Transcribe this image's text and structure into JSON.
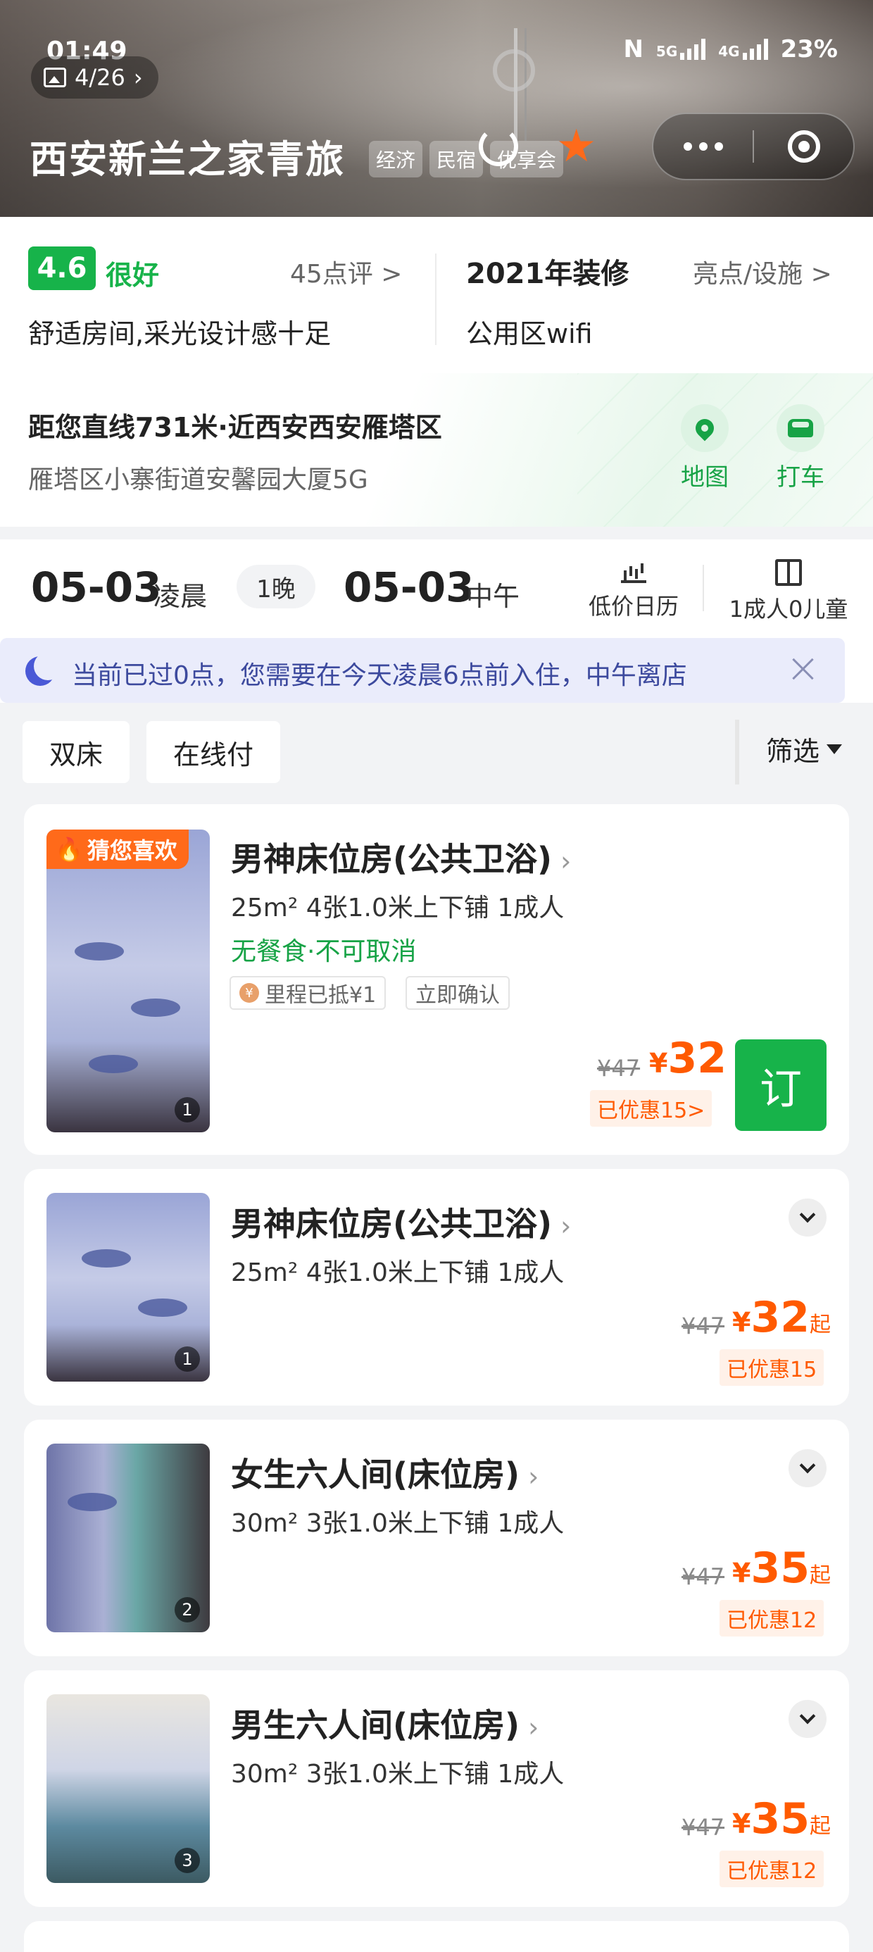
{
  "status": {
    "time": "01:49",
    "network": "5G",
    "network2": "4G",
    "battery": "23%",
    "nfc": "N"
  },
  "gallery": {
    "counter": "4/26"
  },
  "hotel": {
    "name": "西安新兰之家青旅",
    "tags": [
      "经济",
      "民宿",
      "优享会"
    ]
  },
  "rating": {
    "score": "4.6",
    "word": "很好",
    "reviews": "45点评 >",
    "summary": "舒适房间,采光设计感十足"
  },
  "renovation": {
    "year": "2021年装修",
    "highlights": "亮点/设施 >",
    "facility": "公用区wifi"
  },
  "location": {
    "distance": "距您直线731米·近西安西安雁塔区",
    "address": "雁塔区小寨街道安馨园大厦5G",
    "map_label": "地图",
    "taxi_label": "打车"
  },
  "dates": {
    "checkin": "05-03",
    "checkin_time": "凌晨",
    "nights": "1晚",
    "checkout": "05-03",
    "checkout_time": "中午",
    "calendar": "低价日历",
    "guests": "1成人0儿童"
  },
  "notice": {
    "text": "当前已过0点，您需要在今天凌晨6点前入住，中午离店"
  },
  "filters": {
    "items": [
      "双床",
      "在线付"
    ],
    "screen": "筛选"
  },
  "rooms": [
    {
      "badge": "猜您喜欢",
      "name": "男神床位房(公共卫浴)",
      "specs": "25m²   4张1.0米上下铺   1成人",
      "meal": "无餐食·不可取消",
      "tag1": "里程已抵¥1",
      "tag2": "立即确认",
      "old_price": "¥47",
      "yen": "¥",
      "price": "32",
      "discount": "已优惠15>",
      "book": "订",
      "photo_index": "1"
    },
    {
      "name": "男神床位房(公共卫浴)",
      "specs": "25m²   4张1.0米上下铺   1成人",
      "old_price": "¥47",
      "yen": "¥",
      "price": "32",
      "suffix": "起",
      "discount": "已优惠15",
      "photo_index": "1"
    },
    {
      "name": "女生六人间(床位房)",
      "specs": "30m²   3张1.0米上下铺   1成人",
      "old_price": "¥47",
      "yen": "¥",
      "price": "35",
      "suffix": "起",
      "discount": "已优惠12",
      "photo_index": "2"
    },
    {
      "name": "男生六人间(床位房)",
      "specs": "30m²   3张1.0米上下铺   1成人",
      "old_price": "¥47",
      "yen": "¥",
      "price": "35",
      "suffix": "起",
      "discount": "已优惠12",
      "photo_index": "3"
    }
  ],
  "colors": {
    "brand_green": "#17b34a",
    "price_orange": "#ff5a00",
    "notice_bg": "#eaecfb"
  }
}
